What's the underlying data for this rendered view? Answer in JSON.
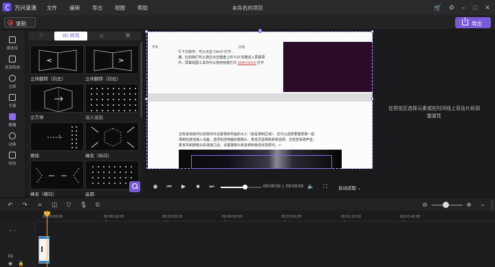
{
  "app": {
    "name": "万兴录演",
    "window_title": "未命名的项目",
    "menu": [
      "文件",
      "编辑",
      "导出",
      "视图",
      "帮助"
    ]
  },
  "toolbar": {
    "record_label": "录制",
    "export_label": "导出"
  },
  "sidebar": {
    "items": [
      {
        "label": "媒体库",
        "icon": "media-library-icon"
      },
      {
        "label": "资源商城",
        "icon": "store-icon"
      },
      {
        "label": "注释",
        "icon": "annotation-icon"
      },
      {
        "label": "字幕",
        "icon": "caption-icon"
      },
      {
        "label": "转场",
        "icon": "transition-icon",
        "active": true
      },
      {
        "label": "动画",
        "icon": "animation-icon"
      },
      {
        "label": "特效",
        "icon": "effects-icon"
      }
    ]
  },
  "panel": {
    "tabs": [
      {
        "icon": "heart-icon",
        "label": ""
      },
      {
        "icon": "3d-icon",
        "label": "3D 转场",
        "active": true
      },
      {
        "icon": "diamond-icon",
        "label": ""
      },
      {
        "icon": "list-icon",
        "label": ""
      }
    ],
    "thumbnails": [
      {
        "label": "立体翻转（向左）"
      },
      {
        "label": "立体翻转（向右）"
      },
      {
        "label": "立方体"
      },
      {
        "label": "淡入淡出"
      },
      {
        "label": "擦除"
      },
      {
        "label": "蜂发（纵向）"
      },
      {
        "label": "蜂发（横向）"
      },
      {
        "label": "晶圆"
      }
    ]
  },
  "preview": {
    "doc_line1": "行下次操作，可以点击 Ctrl+D 打开...",
    "doc_line2": "捕，比如我们可以通过点击键盘上的 F10 快捷进入屏幕录",
    "doc_line3_prefix": "作，屏幕绘图工具你可以使用快捷方式 ",
    "doc_line3_link": "Shift+Ctrl+D",
    "doc_line3_suffix": " 打开",
    "doc_line4": "还有其他操作比如我你可设置录制界面的大小（就是录制区域），还可以选择要捕屏幕一起",
    "doc_line5": "录制的其他输入设备，选项包括电脑的摄像头，麦克风音频和系统音频，在检查系统声音，",
    "doc_line6": "麦克风和摄像头的连接之后，设置摄像头和音频到最佳状态即可。↵",
    "current_time": "00:00:02",
    "total_time": "00:00:03",
    "progress": 0.58,
    "fit_label": "自动适配"
  },
  "properties": {
    "hint": "在预览区选择元素或在时间线上双击片段调整属性"
  },
  "timeline": {
    "ticks": [
      "00:00:00:00",
      "00:00:16:20",
      "00:00:33:10",
      "00:00:50:00",
      "00:01:06:20",
      "00:01:23:10",
      "00:01:40:00"
    ],
    "track_number": "01",
    "zoom_level": 0.45
  }
}
